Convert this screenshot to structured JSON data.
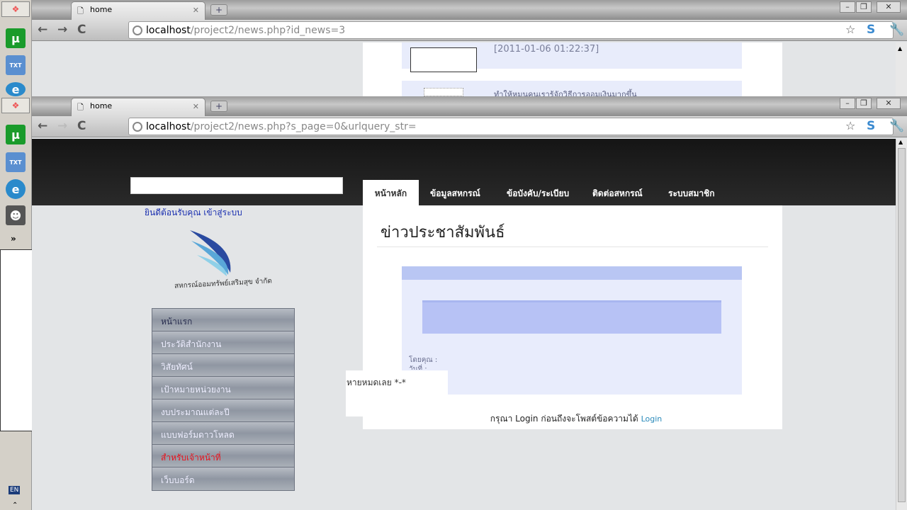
{
  "taskbar": {
    "lang": "EN",
    "more": "»",
    "up": "⌃"
  },
  "windows": [
    {
      "tab_title": "home",
      "url_host": "localhost",
      "url_path": "/project2/news.php?id_news=3",
      "date": "[2011-01-06 01:22:37]",
      "news_text": "ทำให้หมุนคนเรารู้จักวิธีการออมเงินมากขึ้น"
    },
    {
      "tab_title": "home",
      "url_host": "localhost",
      "url_path": "/project2/news.php?s_page=0&urlquery_str="
    }
  ],
  "site": {
    "nav": [
      "หน้าหลัก",
      "ข้อมูลสหกรณ์",
      "ข้อบังคับ/ระเบียบ",
      "ติดต่อสหกรณ์",
      "ระบบสมาชิก"
    ],
    "welcome": "ยินดีต้อนรับคุณ เข้าสู่ระบบ",
    "logo_text": "สหกรณ์ออมทรัพย์เสริมสุข จำกัด",
    "menu": [
      "หน้าแรก",
      "ประวัติสำนักงาน",
      "วิสัยทัศน์",
      "เป้าหมายหน่วยงาน",
      "งบประมาณแต่ละปี",
      "แบบฟอร์มดาวโหลด",
      "สำหรับเจ้าหน้าที่",
      "เว็บบอร์ด"
    ],
    "page_title": "ข่าวประชาสัมพันธ์",
    "by_label": "โดยคุณ :",
    "date_label": "วันที่ :",
    "overlay_text": "หายหมดเลย *-*",
    "login_prompt": "กรุณา Login ก่อนถึงจะโพสต์ข้อความได้",
    "login_link": "Login"
  }
}
